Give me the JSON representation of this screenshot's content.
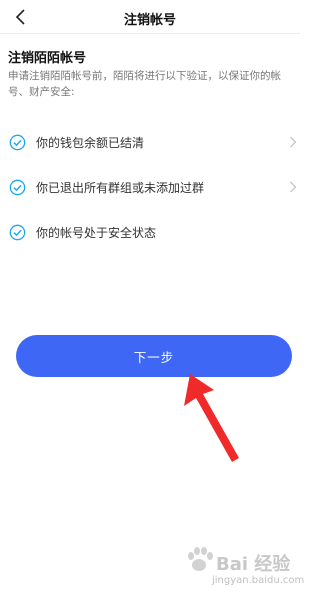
{
  "header": {
    "title": "注销帐号",
    "back_icon": "chevron-left-icon"
  },
  "section": {
    "title": "注销陌陌帐号",
    "description": "申请注销陌陌帐号前，陌陌将进行以下验证，以保证你的帐号、财产安全:"
  },
  "checklist": [
    {
      "label": "你的钱包余额已结清",
      "icon": "check-circle-icon",
      "has_chevron": true
    },
    {
      "label": "你已退出所有群组或未添加过群",
      "icon": "check-circle-icon",
      "has_chevron": true
    },
    {
      "label": "你的帐号处于安全状态",
      "icon": "check-circle-icon",
      "has_chevron": false
    }
  ],
  "next_button": {
    "label": "下一步"
  },
  "watermark": {
    "logo": "Bai 经验",
    "url": "jingyan.baidu.com"
  },
  "colors": {
    "accent": "#3f67f6",
    "check": "#1fa6f0",
    "arrow": "#f02a2a"
  }
}
